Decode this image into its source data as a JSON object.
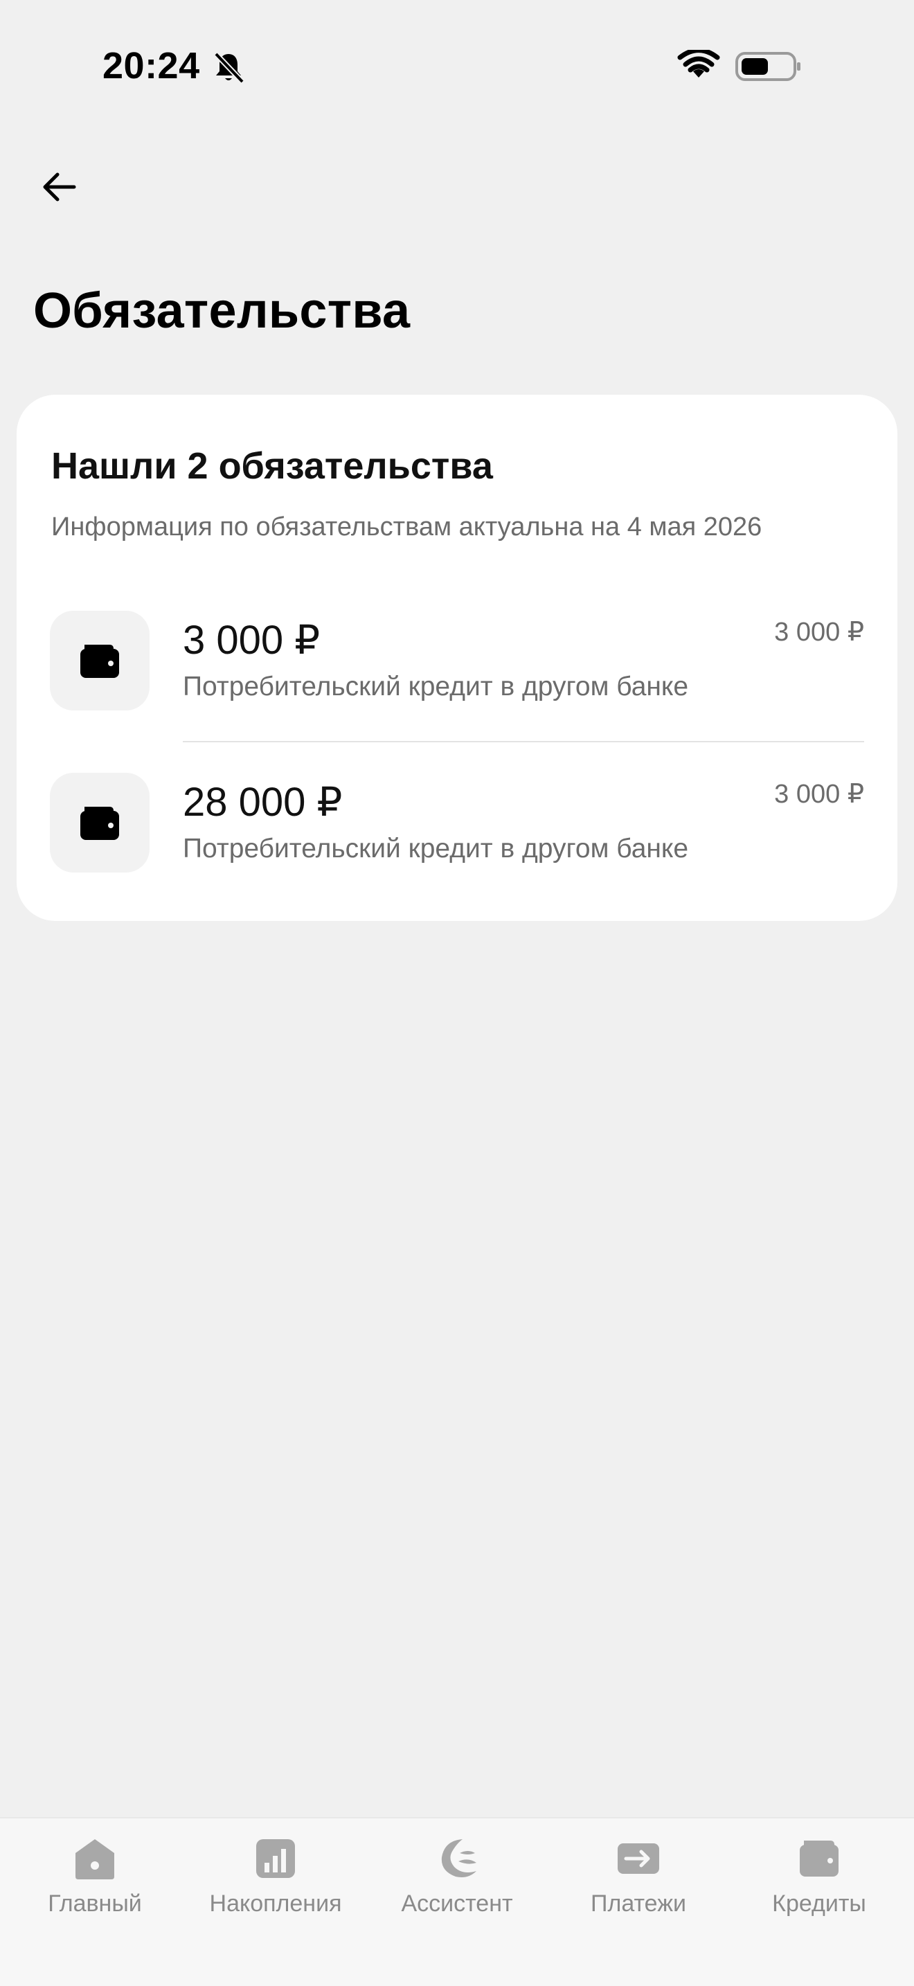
{
  "status_bar": {
    "time": "20:24"
  },
  "header": {
    "title": "Обязательства"
  },
  "summary": {
    "title": "Нашли 2 обязательства",
    "subtitle": "Информация по обязательствам актуальна на 4 мая 2026"
  },
  "debts": [
    {
      "amount": "3 000 ₽",
      "description": "Потребительский кредит в другом банке",
      "side_value": "3 000 ₽",
      "icon": "wallet-icon"
    },
    {
      "amount": "28 000 ₽",
      "description": "Потребительский кредит в другом банке",
      "side_value": "3 000 ₽",
      "icon": "wallet-icon"
    }
  ],
  "nav": {
    "items": [
      {
        "label": "Главный",
        "icon": "home-icon"
      },
      {
        "label": "Накопления",
        "icon": "chart-icon"
      },
      {
        "label": "Ассистент",
        "icon": "assistant-icon"
      },
      {
        "label": "Платежи",
        "icon": "transfer-icon"
      },
      {
        "label": "Кредиты",
        "icon": "wallet-icon"
      }
    ]
  },
  "colors": {
    "background": "#f0f0f0",
    "card": "#ffffff",
    "secondary_text": "#6b6b6b",
    "nav_inactive": "#a8a8a8"
  }
}
